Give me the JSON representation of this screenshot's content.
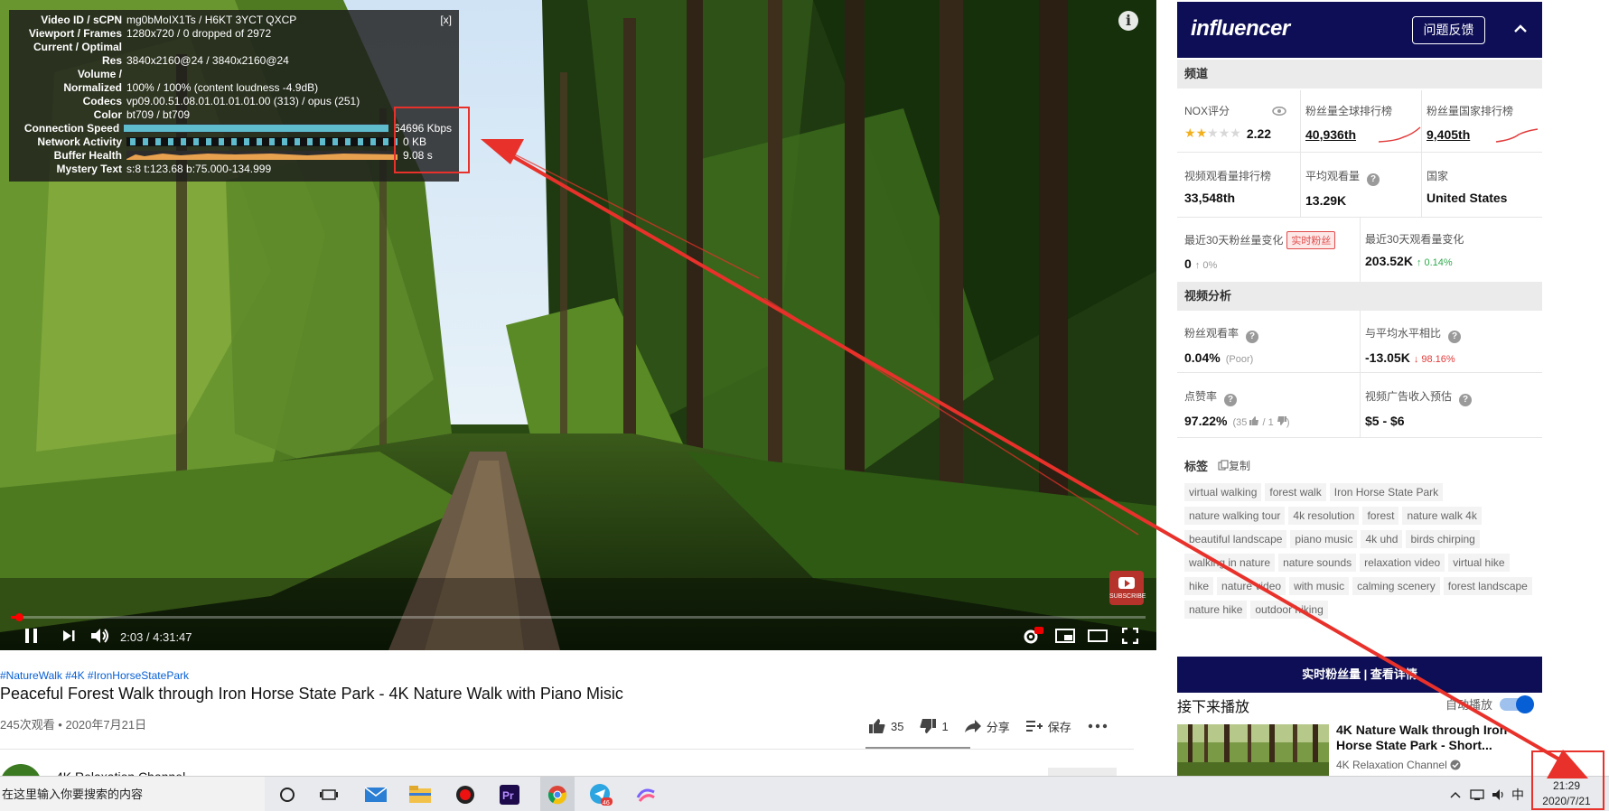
{
  "stats_overlay": {
    "close_label": "[x]",
    "rows": [
      {
        "key": "Video ID / sCPN",
        "value": "mg0bMoIX1Ts / H6KT 3YCT QXCP"
      },
      {
        "key": "Viewport / Frames",
        "value": "1280x720 / 0 dropped of 2972"
      },
      {
        "key": "Current / Optimal",
        "value": ""
      },
      {
        "key": "Res",
        "value": "3840x2160@24 / 3840x2160@24"
      },
      {
        "key": "Volume /",
        "value": ""
      },
      {
        "key": "Normalized",
        "value": "100% / 100% (content loudness -4.9dB)"
      },
      {
        "key": "Codecs",
        "value": "vp09.00.51.08.01.01.01.01.00 (313) / opus (251)"
      },
      {
        "key": "Color",
        "value": "bt709 / bt709"
      },
      {
        "key": "Connection Speed",
        "value": "64696 Kbps"
      },
      {
        "key": "Network Activity",
        "value": "0 KB"
      },
      {
        "key": "Buffer Health",
        "value": "9.08 s"
      },
      {
        "key": "Mystery Text",
        "value": "s:8 t:123.68 b:75.000-134.999"
      }
    ]
  },
  "player": {
    "info_icon": "i",
    "watermark": "SUBSCRIBE",
    "time": "2:03 / 4:31:47",
    "progress_fraction": 0.0075,
    "quality_badge": "4K"
  },
  "video": {
    "hashtags": "#NatureWalk #4K #IronHorseStatePark",
    "title": "Peaceful Forest Walk through Iron Horse State Park - 4K Nature Walk with Piano Misic",
    "views": "245次观看 • 2020年7月21日",
    "likes": "35",
    "dislikes": "1",
    "share": "分享",
    "save": "保存",
    "channel": "4K Relaxation Channel"
  },
  "panel": {
    "logo": "influencer",
    "feedback": "问题反馈",
    "section_channel": "频道",
    "nox_label": "NOX评分",
    "nox_value": "2.22",
    "nox_stars": 2,
    "global_rank_label": "粉丝量全球排行榜",
    "global_rank_value": "40,936th",
    "country_rank_label": "粉丝量国家排行榜",
    "country_rank_value": "9,405th",
    "views_rank_label": "视频观看量排行榜",
    "views_rank_value": "33,548th",
    "avg_views_label": "平均观看量",
    "avg_views_value": "13.29K",
    "country_label": "国家",
    "country_value": "United States",
    "fans_change_label": "最近30天粉丝量变化",
    "realtime_badge": "实时粉丝",
    "fans_change_value": "0",
    "fans_change_pct": "↑ 0%",
    "views_change_label": "最近30天观看量变化",
    "views_change_value": "203.52K",
    "views_change_pct": "↑ 0.14%",
    "section_video": "视频分析",
    "fan_view_rate_label": "粉丝观看率",
    "fan_view_rate_value": "0.04%",
    "fan_view_rate_note": "(Poor)",
    "vs_avg_label": "与平均水平相比",
    "vs_avg_value": "-13.05K",
    "vs_avg_pct": "↓ 98.16%",
    "like_rate_label": "点赞率",
    "like_rate_value": "97.22%",
    "like_rate_note_open": "(35",
    "like_rate_note_mid": "/ 1",
    "like_rate_note_close": ")",
    "ad_revenue_label": "视频广告收入预估",
    "ad_revenue_value": "$5 - $6",
    "tags_label": "标签",
    "copy_label": "复制",
    "tags": [
      "virtual walking",
      "forest walk",
      "Iron Horse State Park",
      "nature walking tour",
      "4k resolution",
      "forest",
      "nature walk 4k",
      "beautiful landscape",
      "piano music",
      "4k uhd",
      "birds chirping",
      "walking in nature",
      "nature sounds",
      "relaxation video",
      "virtual hike",
      "hike",
      "nature video",
      "with music",
      "calming scenery",
      "forest landscape",
      "nature hike",
      "outdoor hiking"
    ],
    "realtime_bar": "实时粉丝量 | 查看详情"
  },
  "up_next": {
    "title": "接下来播放",
    "autoplay": "自动播放",
    "rec_title": "4K Nature Walk through Iron Horse State Park - Short...",
    "rec_channel": "4K Relaxation Channel"
  },
  "taskbar": {
    "search_placeholder": "在这里输入你要搜索的内容",
    "telegram_badge": "46",
    "ime": "中",
    "time": "21:29",
    "date": "2020/7/21"
  },
  "colors": {
    "panel_navy": "#0d0e55",
    "annotation_red": "#e8312a",
    "like_green": "#2eaa4b",
    "decline_red": "#e23b3b",
    "link_blue": "#065fd4"
  }
}
